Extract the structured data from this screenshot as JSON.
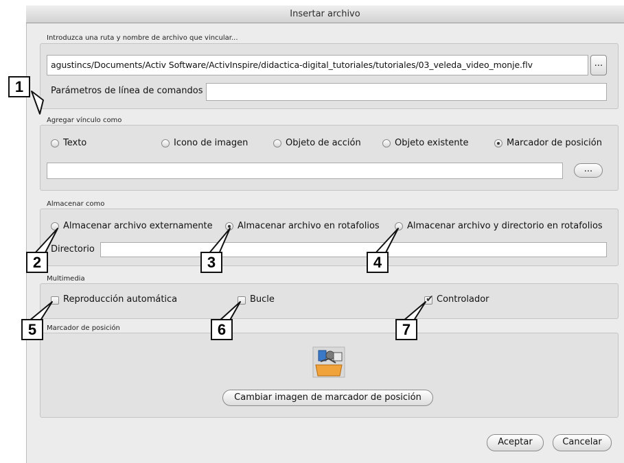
{
  "dialog": {
    "title": "Insertar archivo",
    "path_prompt": "Introduzca una ruta y nombre de archivo que vincular...",
    "path_value": "agustincs/Documents/Activ Software/ActivInspire/didactica-digital_tutoriales/tutoriales/03_veleda_video_monje.flv",
    "browse_label": "...",
    "params_label": "Parámetros de línea de comandos",
    "params_value": ""
  },
  "link_as": {
    "legend": "Agregar vínculo como",
    "options": [
      "Texto",
      "Icono de imagen",
      "Objeto de acción",
      "Objeto existente",
      "Marcador de posición"
    ],
    "selected": "Marcador de posición",
    "text_value": "",
    "browse_label": "..."
  },
  "store_as": {
    "legend": "Almacenar como",
    "options": [
      "Almacenar archivo externamente",
      "Almacenar archivo en rotafolios",
      "Almacenar archivo y directorio en rotafolios"
    ],
    "selected": "Almacenar archivo en rotafolios",
    "directory_label": "Directorio",
    "directory_value": ""
  },
  "multimedia": {
    "legend": "Multimedia",
    "autoplay_label": "Reproducción automática",
    "autoplay_checked": false,
    "loop_label": "Bucle",
    "loop_checked": false,
    "controller_label": "Controlador",
    "controller_checked": true
  },
  "placeholder": {
    "legend": "Marcador de posición",
    "change_image_label": "Cambiar imagen de marcador de posición",
    "image_icon": "placeholder-media-icon"
  },
  "footer": {
    "ok_label": "Aceptar",
    "cancel_label": "Cancelar"
  },
  "callouts": [
    "1",
    "2",
    "3",
    "4",
    "5",
    "6",
    "7"
  ],
  "colors": {
    "window_bg": "#ececec",
    "group_bg": "#e2e2e2",
    "callout_border": "#111111"
  }
}
